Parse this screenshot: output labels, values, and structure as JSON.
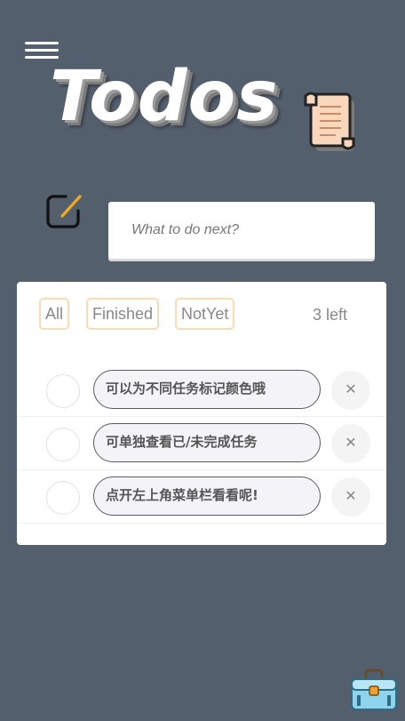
{
  "header": {
    "menu_icon": "hamburger-icon",
    "title": "Todos",
    "title_icon": "scroll-icon"
  },
  "input": {
    "icon": "edit-icon",
    "placeholder": "What to do next?",
    "value": ""
  },
  "filters": {
    "all": "All",
    "finished": "Finished",
    "notyet": "NotYet",
    "left_count": "3 left"
  },
  "todos": [
    {
      "text": "可以为不同任务标记颜色哦",
      "done": false
    },
    {
      "text": "可单独查看已/未完成任务",
      "done": false
    },
    {
      "text": "点开左上角菜单栏看看呢!",
      "done": false
    }
  ],
  "delete_label": "✕",
  "footer": {
    "toolbox_icon": "toolbox-icon"
  },
  "colors": {
    "background": "#545f6e",
    "filter_border": "#f6ddb6",
    "card": "#ffffff",
    "pill_border": "#565b66",
    "pill_bg": "#f4f4f8"
  }
}
